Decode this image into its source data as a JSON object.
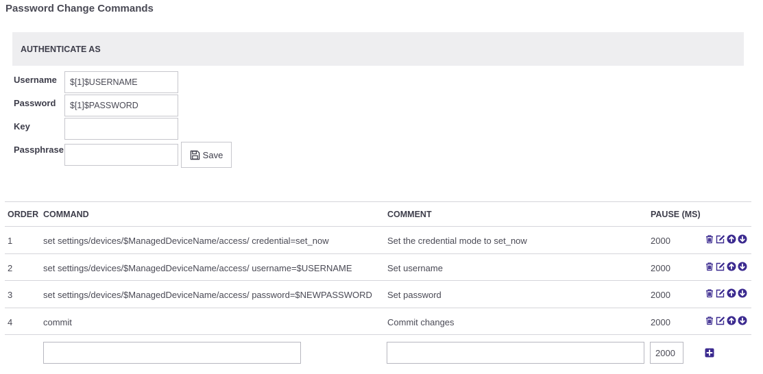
{
  "page": {
    "title": "Password Change Commands"
  },
  "auth": {
    "header": "AUTHENTICATE AS",
    "username_label": "Username",
    "username_value": "$[1]$USERNAME",
    "password_label": "Password",
    "password_value": "$[1]$PASSWORD",
    "key_label": "Key",
    "key_value": "",
    "passphrase_label": "Passphrase",
    "passphrase_value": "",
    "save_label": "Save"
  },
  "table": {
    "headers": {
      "order": "ORDER",
      "command": "COMMAND",
      "comment": "COMMENT",
      "pause": "PAUSE (MS)"
    },
    "rows": [
      {
        "order": "1",
        "command": "set settings/devices/$ManagedDeviceName/access/ credential=set_now",
        "comment": "Set the credential mode to set_now",
        "pause": "2000"
      },
      {
        "order": "2",
        "command": "set settings/devices/$ManagedDeviceName/access/ username=$USERNAME",
        "comment": "Set username",
        "pause": "2000"
      },
      {
        "order": "3",
        "command": "set settings/devices/$ManagedDeviceName/access/ password=$NEWPASSWORD",
        "comment": "Set password",
        "pause": "2000"
      },
      {
        "order": "4",
        "command": "commit",
        "comment": "Commit changes",
        "pause": "2000"
      }
    ],
    "new_row": {
      "command_value": "",
      "comment_value": "",
      "pause_value": "2000"
    }
  },
  "colors": {
    "icon": "#3b2a8f",
    "header_bg": "#eeeef0",
    "divider": "#d5d5da"
  },
  "icons": {
    "row_actions": [
      "trash-icon",
      "edit-icon",
      "arrow-up-circle-icon",
      "arrow-down-circle-icon"
    ],
    "add": "plus-square-icon",
    "save": "floppy-disk-icon"
  }
}
